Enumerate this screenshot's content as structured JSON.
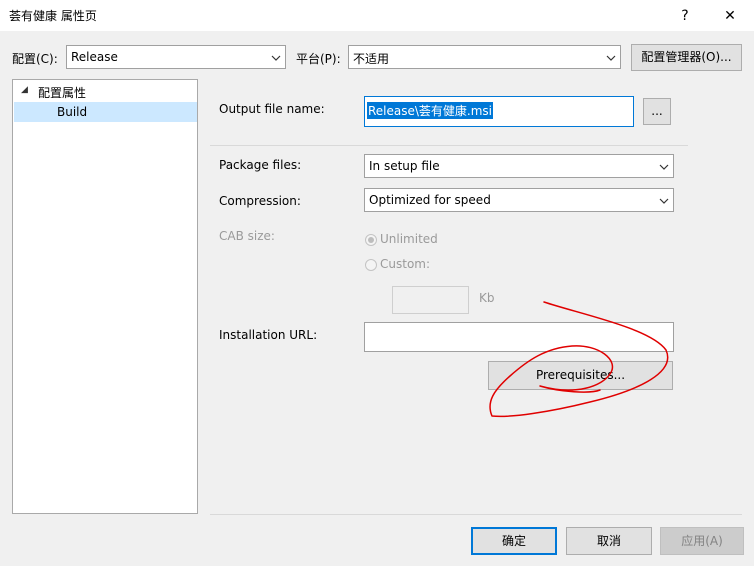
{
  "window": {
    "title": "荟有健康 属性页",
    "help_glyph": "?",
    "close_glyph": "✕"
  },
  "toolbar": {
    "config_label": "配置(C):",
    "config_value": "Release",
    "platform_label": "平台(P):",
    "platform_value": "不适用",
    "config_manager_label": "配置管理器(O)..."
  },
  "tree": {
    "root_label": "配置属性",
    "root_expander": "◢",
    "child_label": "Build"
  },
  "form": {
    "output_file_label": "Output file name:",
    "output_file_value": "Release\\荟有健康.msi",
    "browse_label": "...",
    "package_files_label": "Package files:",
    "package_files_value": "In setup file",
    "compression_label": "Compression:",
    "compression_value": "Optimized for speed",
    "cab_size_label": "CAB size:",
    "unlimited_label": "Unlimited",
    "custom_label": "Custom:",
    "custom_unit": "Kb",
    "installation_url_label": "Installation URL:",
    "installation_url_value": "",
    "prerequisites_label": "Prerequisites..."
  },
  "footer": {
    "ok_label": "确定",
    "cancel_label": "取消",
    "apply_label": "应用(A)"
  },
  "colors": {
    "selection": "#0078d7",
    "annotation": "#e00000"
  }
}
